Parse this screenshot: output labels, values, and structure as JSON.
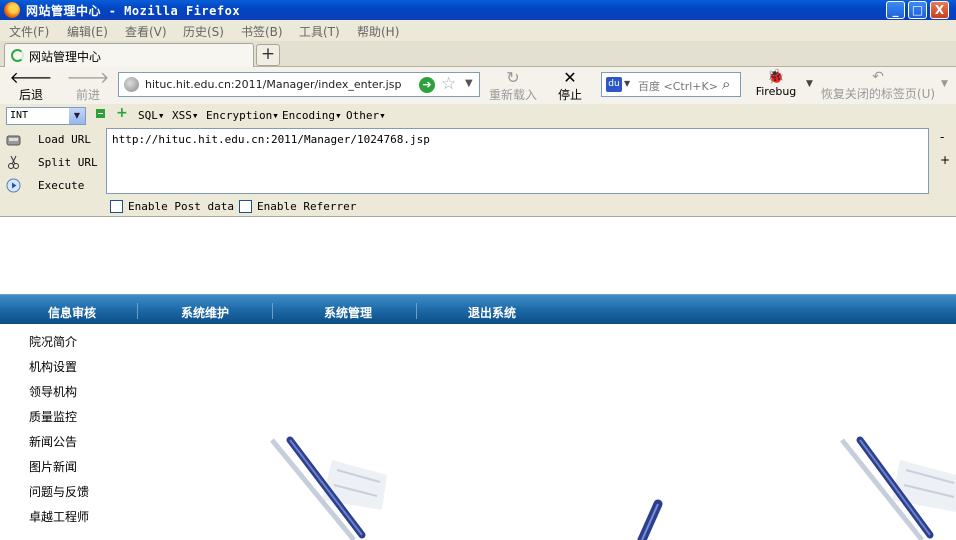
{
  "window": {
    "title": "网站管理中心 - Mozilla Firefox",
    "min": "_",
    "max": "□",
    "close": "X"
  },
  "menu": [
    "文件(F)",
    "编辑(E)",
    "查看(V)",
    "历史(S)",
    "书签(B)",
    "工具(T)",
    "帮助(H)"
  ],
  "tabs": [
    {
      "label": "网站管理中心"
    }
  ],
  "newtab": "+",
  "nav": {
    "back": "后退",
    "forward": "前进",
    "url": "hituc.hit.edu.cn:2011/Manager/index_enter.jsp",
    "reload": "重新载入",
    "stop": "停止",
    "search_placeholder": "百度 <Ctrl+K>",
    "engine": "du",
    "firebug": "Firebug",
    "restore_closed": "恢复关闭的标签页(U)"
  },
  "hackbar": {
    "select_value": "INT",
    "menus": [
      "SQL▾",
      "XSS▾",
      "Encryption▾",
      "Encoding▾",
      "Other▾"
    ],
    "actions": [
      "Load URL",
      "Split URL",
      "Execute"
    ],
    "textarea": "http://hituc.hit.edu.cn:2011/Manager/1024768.jsp",
    "side_minus": "-",
    "side_plus": "+",
    "checks": [
      "Enable Post data",
      "Enable Referrer"
    ]
  },
  "page": {
    "topnav": [
      "信息审核",
      "系统维护",
      "系统管理",
      "退出系统"
    ],
    "sidebar": [
      "院况简介",
      "机构设置",
      "领导机构",
      "质量监控",
      "新闻公告",
      "图片新闻",
      "问题与反馈",
      "卓越工程师"
    ]
  },
  "colors": {
    "titlebar": "#0245c4",
    "nav_strip": "#1e6aa8",
    "hackbar_bg": "#ece9d8"
  }
}
